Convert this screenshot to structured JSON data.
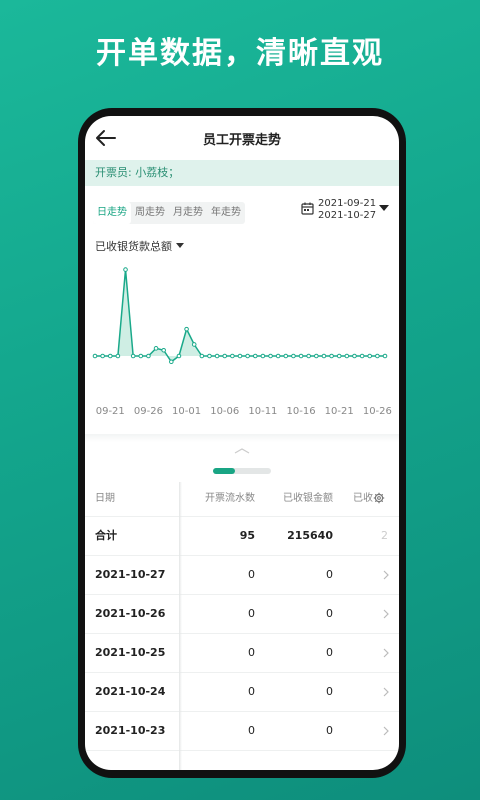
{
  "headline": "开单数据，清晰直观",
  "navbar": {
    "title": "员工开票走势"
  },
  "issuer_bar": {
    "text": "开票员: 小荔枝；"
  },
  "tabs": [
    {
      "label": "日走势",
      "active": true
    },
    {
      "label": "周走势",
      "active": false
    },
    {
      "label": "月走势",
      "active": false
    },
    {
      "label": "年走势",
      "active": false
    }
  ],
  "date_range": {
    "start": "2021-09-21",
    "end": "2021-10-27"
  },
  "metric": {
    "label": "已收银货款总额"
  },
  "chart_data": {
    "type": "area",
    "x_tick_labels": [
      "09-21",
      "09-26",
      "10-01",
      "10-06",
      "10-11",
      "10-16",
      "10-21",
      "10-26"
    ],
    "x": [
      "09-19",
      "09-20",
      "09-21",
      "09-22",
      "09-23",
      "09-24",
      "09-25",
      "09-26",
      "09-27",
      "09-28",
      "09-29",
      "09-30",
      "10-01",
      "10-02",
      "10-03",
      "10-04",
      "10-05",
      "10-06",
      "10-07",
      "10-08",
      "10-09",
      "10-10",
      "10-11",
      "10-12",
      "10-13",
      "10-14",
      "10-15",
      "10-16",
      "10-17",
      "10-18",
      "10-19",
      "10-20",
      "10-21",
      "10-22",
      "10-23",
      "10-24",
      "10-25",
      "10-26",
      "10-27"
    ],
    "values": [
      0,
      0,
      0,
      0,
      90,
      0,
      0,
      0,
      8,
      6,
      -6,
      0,
      28,
      12,
      0,
      0,
      0,
      0,
      0,
      0,
      0,
      0,
      0,
      0,
      0,
      0,
      0,
      0,
      0,
      0,
      0,
      0,
      0,
      0,
      0,
      0,
      0,
      0,
      0
    ],
    "series_color": "#1aa98a",
    "fill_color": "#cfeee4",
    "grid": false,
    "legend": "none"
  },
  "table": {
    "headers": {
      "date": "日期",
      "flow": "开票流水数",
      "amount": "已收银金额",
      "more": "已收"
    },
    "rows": [
      {
        "date": "合计",
        "flow": "95",
        "amount": "215640",
        "more": "2"
      },
      {
        "date": "2021-10-27",
        "flow": "0",
        "amount": "0"
      },
      {
        "date": "2021-10-26",
        "flow": "0",
        "amount": "0"
      },
      {
        "date": "2021-10-25",
        "flow": "0",
        "amount": "0"
      },
      {
        "date": "2021-10-24",
        "flow": "0",
        "amount": "0"
      },
      {
        "date": "2021-10-23",
        "flow": "0",
        "amount": "0"
      }
    ]
  }
}
